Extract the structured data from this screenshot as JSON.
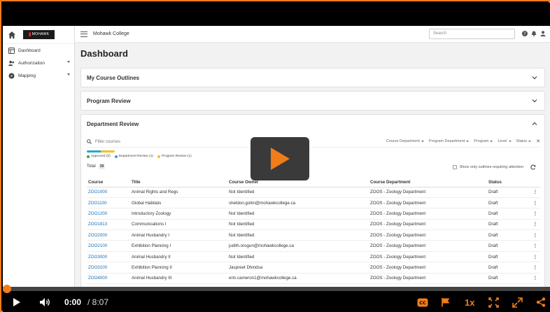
{
  "sidebar": {
    "logo_text": "MOHAWK",
    "items": [
      {
        "label": "Dashboard",
        "icon": "dashboard-icon"
      },
      {
        "label": "Authorization",
        "icon": "users-icon",
        "has_caret": true
      },
      {
        "label": "Mapping",
        "icon": "compass-icon",
        "has_caret": true
      }
    ]
  },
  "header": {
    "org_name": "Mohawk College",
    "search_placeholder": "Search"
  },
  "page": {
    "title": "Dashboard"
  },
  "sections": {
    "my_course_outlines": "My Course Outlines",
    "program_review": "Program Review",
    "department_review": "Department Review"
  },
  "department_review": {
    "filter_placeholder": "Filter courses",
    "filters": [
      "Course Department",
      "Program Department",
      "Program",
      "Level",
      "Status"
    ],
    "legend": [
      {
        "label": "Approved (0)",
        "color": "#2fa84f"
      },
      {
        "label": "Department Review (1)",
        "color": "#2aa7c9"
      },
      {
        "label": "Program Review (1)",
        "color": "#f3c21a"
      }
    ],
    "progress": [
      {
        "fraction": 0.5,
        "color": "#2aa7c9"
      },
      {
        "fraction": 0.5,
        "color": "#f3c21a"
      }
    ],
    "total_label": "Total",
    "total_value": "39",
    "attention_label": "Show only outlines requiring attention",
    "columns": [
      "Course",
      "Title",
      "Course Owner",
      "Course Department",
      "Status"
    ],
    "rows": [
      {
        "course": "ZOO1000",
        "title": "Animal Rights and Regs",
        "owner": "Not Identified",
        "dept": "ZOOS - Zoology Department",
        "status": "Draft"
      },
      {
        "course": "ZOO1100",
        "title": "Global Habitats",
        "owner": "sheldon.golini@mohawkcollege.ca",
        "dept": "ZOOS - Zoology Department",
        "status": "Draft"
      },
      {
        "course": "ZOO1200",
        "title": "Introductory Zoology",
        "owner": "Not Identified",
        "dept": "ZOOS - Zoology Department",
        "status": "Draft"
      },
      {
        "course": "ZOO1813",
        "title": "Communications I",
        "owner": "Not Identified",
        "dept": "ZOOS - Zoology Department",
        "status": "Draft"
      },
      {
        "course": "ZOO2000",
        "title": "Animal Husbandry I",
        "owner": "Not Identified",
        "dept": "ZOOS - Zoology Department",
        "status": "Draft"
      },
      {
        "course": "ZOO2100",
        "title": "Exhibition Planning I",
        "owner": "judith.orogun@mohawkcollege.ca",
        "dept": "ZOOS - Zoology Department",
        "status": "Draft"
      },
      {
        "course": "ZOO3000",
        "title": "Animal Husbandry II",
        "owner": "Not Identified",
        "dept": "ZOOS - Zoology Department",
        "status": "Draft"
      },
      {
        "course": "ZOO3100",
        "title": "Exhibition Planning II",
        "owner": "Jaspreet Dhindsa",
        "dept": "ZOOS - Zoology Department",
        "status": "Draft"
      },
      {
        "course": "ZOO4000",
        "title": "Animal Husbandry III",
        "owner": "erin.cameron1@mohawkcollege.ca",
        "dept": "ZOOS - Zoology Department",
        "status": "Draft"
      }
    ]
  },
  "player": {
    "current_time": "0:00",
    "total_time": "/ 8:07",
    "speed": "1x",
    "progress": 0,
    "accent_color": "#f07c1a"
  }
}
